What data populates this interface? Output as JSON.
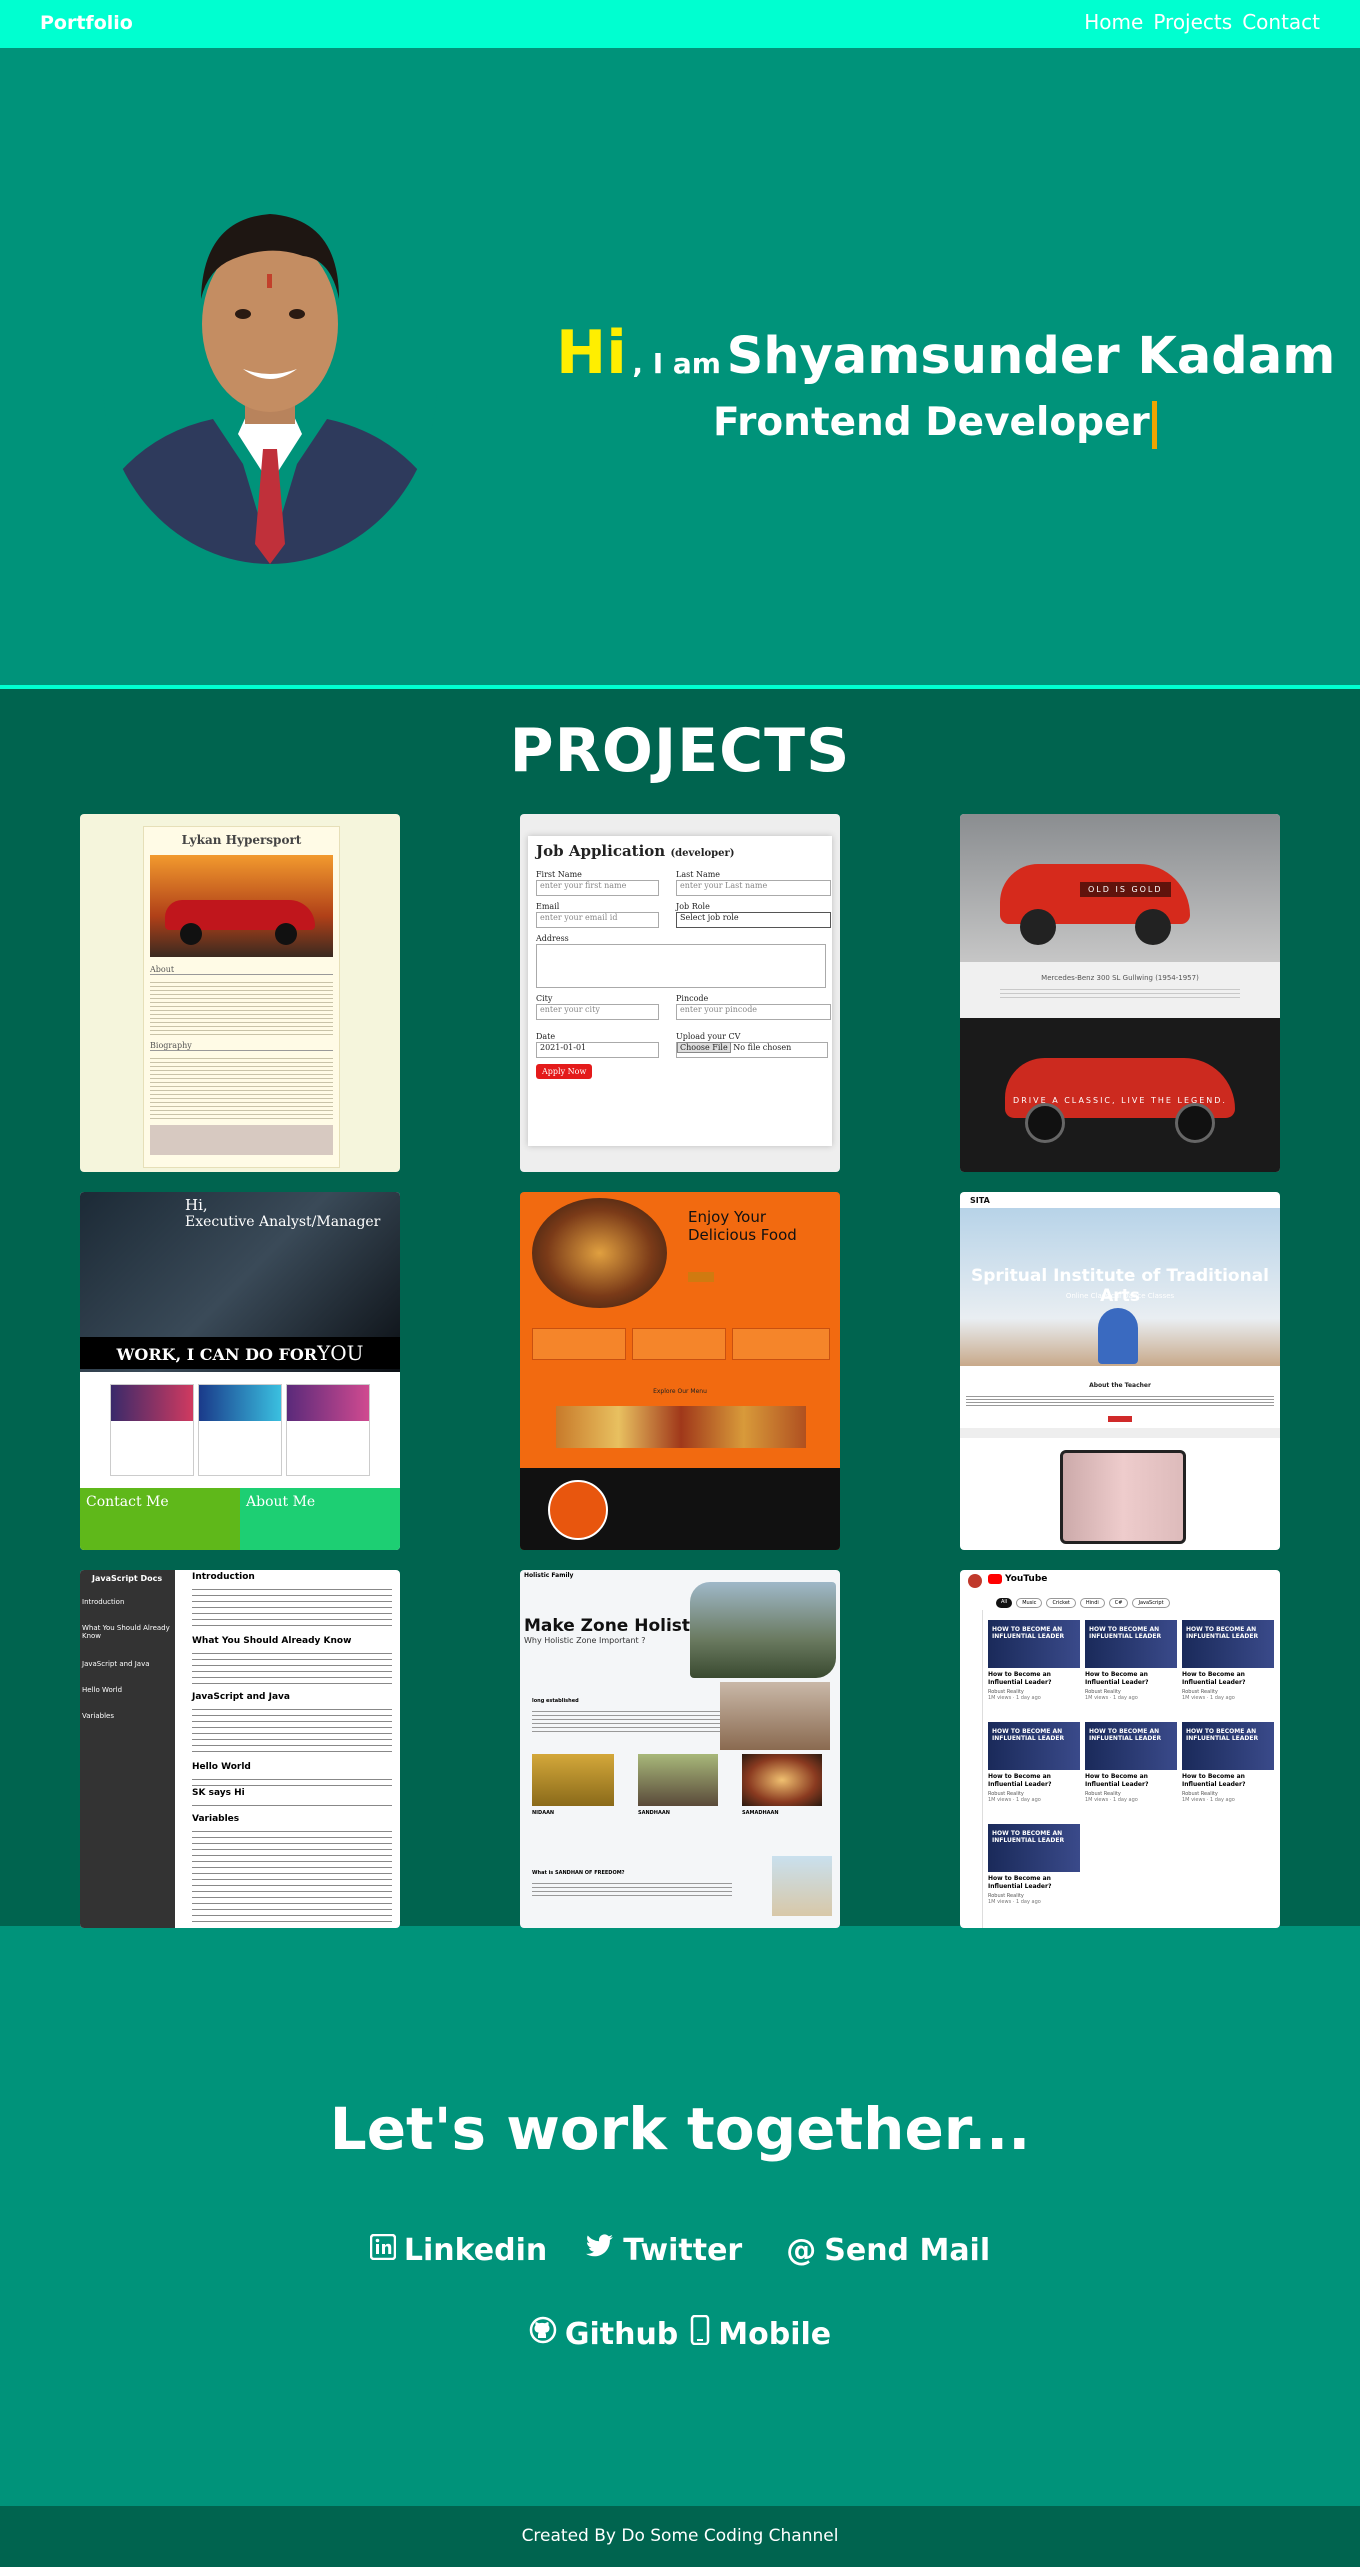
{
  "nav": {
    "brand": "Portfolio",
    "links": [
      "Home",
      "Projects",
      "Contact"
    ]
  },
  "hero": {
    "hi": "Hi",
    "iam": ", I am",
    "name": "Shyamsunder Kadam",
    "role": "Frontend Developer"
  },
  "projects": {
    "title": "PROJECTS",
    "lykan": {
      "title": "Lykan Hypersport",
      "about": "About",
      "bio": "Biography"
    },
    "job": {
      "title": "Job Application",
      "sub": "(developer)",
      "first": "First Name",
      "last": "Last Name",
      "first_ph": "enter your first name",
      "last_ph": "enter your Last name",
      "email": "Email",
      "email_ph": "enter your email id",
      "jobrole": "Job Role",
      "jobrole_sel": "Select job role",
      "address": "Address",
      "city": "City",
      "city_ph": "enter your city",
      "pincode": "Pincode",
      "pincode_ph": "enter your pincode",
      "date": "Date",
      "date_val": "2021-01-01",
      "cv": "Upload your CV",
      "choose": "Choose File",
      "nofile": "No file chosen",
      "apply": "Apply Now"
    },
    "car": {
      "badge": "OLD IS GOLD",
      "caption": "Mercedes-Benz 300 SL Gullwing (1954-1957)",
      "tagline": "DRIVE A CLASSIC, LIVE THE LEGEND."
    },
    "exec": {
      "hi": "Hi,",
      "role": "Executive Analyst/Manager",
      "work": "WORK, I CAN DO FOR",
      "you": "YOU",
      "contact": "Contact Me",
      "about": "About Me"
    },
    "food": {
      "title": "Enjoy Your Delicious Food",
      "menu": "Explore Our Menu"
    },
    "sita": {
      "brand": "SITA",
      "title": "Spritual Institute of Traditional Arts",
      "sub": "Online Classical Dance Classes",
      "teacher": "About the Teacher"
    },
    "js": {
      "brand": "JavaScript Docs",
      "side": [
        "Introduction",
        "What You Should Already Know",
        "JavaScript and Java",
        "Hello World",
        "Variables"
      ],
      "h1": "Introduction",
      "h2": "What You Should Already Know",
      "h3": "JavaScript and Java",
      "h4": "Hello World",
      "sk": "SK says Hi",
      "h5": "Variables"
    },
    "holistic": {
      "brand": "Holistic Family",
      "title": "Make Zone Holistic !",
      "sub": "Why Holistic Zone Important ?",
      "long": "long established",
      "cap1": "NIDAAN",
      "cap2": "SANDHAAN",
      "cap3": "SAMADHAAN",
      "q": "What is SANDHAN OF FREEDOM?"
    },
    "yt": {
      "brand": "YouTube",
      "chips": [
        "All",
        "Music",
        "Cricket",
        "Hindi",
        "C#",
        "JavaScript"
      ],
      "thumb": "HOW TO BECOME AN INFLUENTIAL LEADER",
      "video": "How to Become an Influential Leader?",
      "channel": "Robust Reality",
      "meta": "1M views · 1 day ago"
    }
  },
  "contact": {
    "title": "Let's work together...",
    "linkedin": "Linkedin",
    "twitter": "Twitter",
    "mail": "Send Mail",
    "github": "Github",
    "mobile": "Mobile"
  },
  "footer": "Created By Do Some Coding Channel"
}
